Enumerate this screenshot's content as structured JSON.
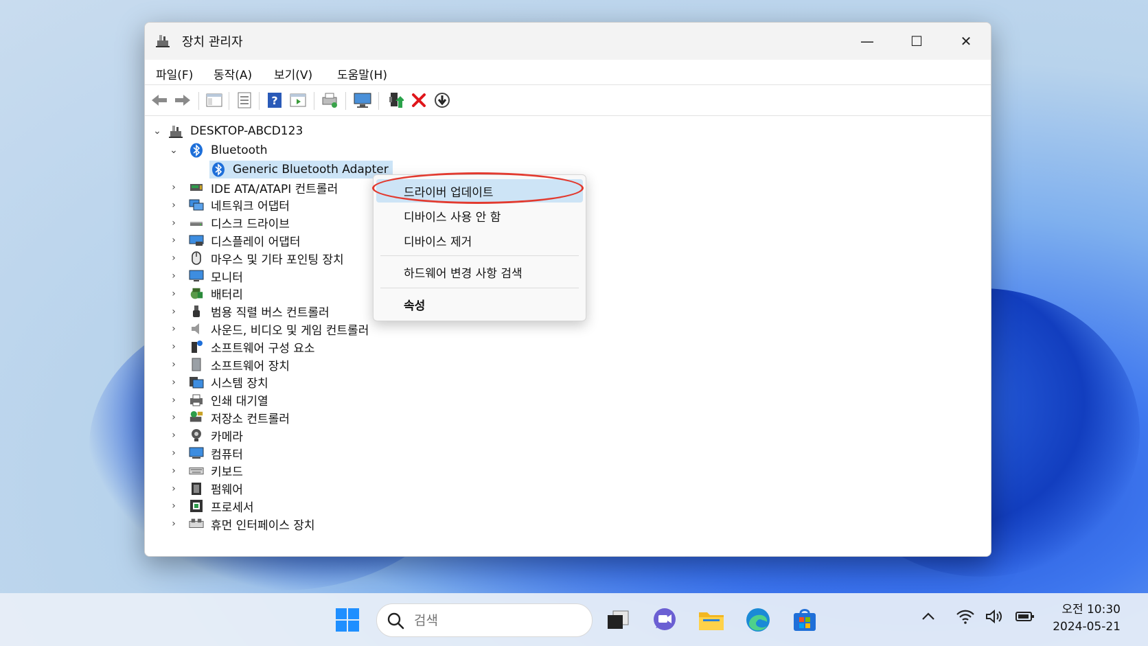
{
  "window": {
    "title": "장치 관리자",
    "minimize_glyph": "—",
    "maximize_glyph": "☐",
    "close_glyph": "✕"
  },
  "menubar": [
    "파일(F)",
    "동작(A)",
    "보기(V)",
    "도움말(H)"
  ],
  "toolbar_icons": [
    "back-arrow-icon",
    "forward-arrow-icon",
    "show-hide-console-tree-icon",
    "properties-sheet-icon",
    "help-icon",
    "action-pane-icon",
    "print-icon",
    "monitor-display-icon",
    "update-driver-icon",
    "uninstall-device-icon",
    "disable-device-icon"
  ],
  "tree": {
    "root": "DESKTOP-ABCD123",
    "bluetooth": "Bluetooth",
    "selected_device": "Generic Bluetooth Adapter",
    "categories": [
      {
        "label": "IDE ATA/ATAPI 컨트롤러",
        "icon": "ide-controller-icon"
      },
      {
        "label": "네트워크 어댑터",
        "icon": "network-adapter-icon"
      },
      {
        "label": "디스크 드라이브",
        "icon": "disk-drive-icon"
      },
      {
        "label": "디스플레이 어댑터",
        "icon": "display-adapter-icon"
      },
      {
        "label": "마우스 및 기타 포인팅 장치",
        "icon": "mouse-icon"
      },
      {
        "label": "모니터",
        "icon": "monitor-icon"
      },
      {
        "label": "배터리",
        "icon": "battery-icon"
      },
      {
        "label": "범용 직렬 버스 컨트롤러",
        "icon": "usb-icon"
      },
      {
        "label": "사운드, 비디오 및 게임 컨트롤러",
        "icon": "speaker-icon"
      },
      {
        "label": "소프트웨어 구성 요소",
        "icon": "software-component-icon"
      },
      {
        "label": "소프트웨어 장치",
        "icon": "software-device-icon"
      },
      {
        "label": "시스템 장치",
        "icon": "system-device-icon"
      },
      {
        "label": "인쇄 대기열",
        "icon": "printer-icon"
      },
      {
        "label": "저장소 컨트롤러",
        "icon": "storage-controller-icon"
      },
      {
        "label": "카메라",
        "icon": "camera-icon"
      },
      {
        "label": "컴퓨터",
        "icon": "computer-icon"
      },
      {
        "label": "키보드",
        "icon": "keyboard-icon"
      },
      {
        "label": "펌웨어",
        "icon": "firmware-icon"
      },
      {
        "label": "프로세서",
        "icon": "processor-icon"
      },
      {
        "label": "휴먼 인터페이스 장치",
        "icon": "hid-icon"
      }
    ]
  },
  "context_menu": {
    "update_driver": "드라이버 업데이트",
    "disable_device": "디바이스 사용 안 함",
    "uninstall_device": "디바이스 제거",
    "scan_hardware": "하드웨어 변경 사항 검색",
    "properties": "속성"
  },
  "taskbar": {
    "search_placeholder": "검색",
    "clock_time": "오전 10:30",
    "clock_date": "2024-05-21"
  },
  "colors": {
    "selection": "#cce4f7",
    "highlight_ring": "#e23a2f",
    "accent": "#0067c0"
  }
}
